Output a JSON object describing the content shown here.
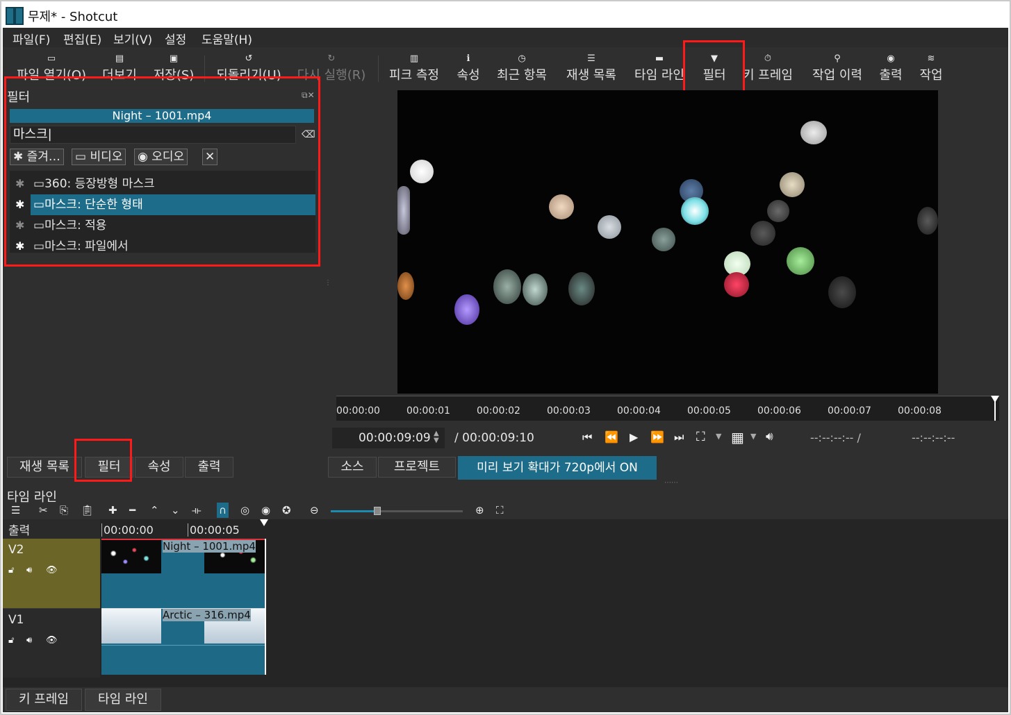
{
  "window": {
    "title": "무제* - Shotcut"
  },
  "menu": [
    "파일(F)",
    "편집(E)",
    "보기(V)",
    "설정",
    "도움말(H)"
  ],
  "toolbar": [
    {
      "label": "파일 열기(O)",
      "icon": "folder-open-icon",
      "enabled": true
    },
    {
      "label": "더보기",
      "icon": "file-icon",
      "enabled": true
    },
    {
      "label": "저장(S)",
      "icon": "save-icon",
      "enabled": true
    },
    {
      "label": "되돌리기(U)",
      "icon": "undo-icon",
      "enabled": true
    },
    {
      "label": "다시 실행(R)",
      "icon": "redo-icon",
      "enabled": false
    },
    {
      "label": "피크 측정",
      "icon": "peak-meter-icon",
      "enabled": true
    },
    {
      "label": "속성",
      "icon": "info-icon",
      "enabled": true
    },
    {
      "label": "최근 항목",
      "icon": "clock-icon",
      "enabled": true
    },
    {
      "label": "재생 목록",
      "icon": "list-icon",
      "enabled": true
    },
    {
      "label": "타임 라인",
      "icon": "timeline-icon",
      "enabled": true
    },
    {
      "label": "필터",
      "icon": "filter-icon",
      "enabled": true
    },
    {
      "label": "키 프레임",
      "icon": "stopwatch-icon",
      "enabled": true
    },
    {
      "label": "작업 이력",
      "icon": "history-icon",
      "enabled": true
    },
    {
      "label": "출력",
      "icon": "disc-icon",
      "enabled": true
    },
    {
      "label": "작업",
      "icon": "database-icon",
      "enabled": true
    }
  ],
  "filters_panel": {
    "title": "필터",
    "clip_name": "Night – 1001.mp4",
    "search_value": "마스크|",
    "chips": [
      "즐겨…",
      "비디오",
      "오디오"
    ],
    "items": [
      {
        "label": "360: 등장방형 마스크",
        "favorite": false,
        "selected": false
      },
      {
        "label": "마스크: 단순한 형태",
        "favorite": true,
        "selected": true
      },
      {
        "label": "마스크: 적용",
        "favorite": false,
        "selected": false
      },
      {
        "label": "마스크: 파일에서",
        "favorite": true,
        "selected": false
      }
    ]
  },
  "ruler": {
    "ticks": [
      "00:00:00",
      "00:00:01",
      "00:00:02",
      "00:00:03",
      "00:00:04",
      "00:00:05",
      "00:00:06",
      "00:00:07",
      "00:00:08"
    ]
  },
  "transport": {
    "position": "00:00:09:09",
    "duration": "/ 00:00:09:10",
    "in_point": "--:--:--:-- /",
    "out_point": "--:--:--:--"
  },
  "left_tabs": [
    "재생 목록",
    "필터",
    "속성",
    "출력"
  ],
  "player_tabs": [
    "소스",
    "프로젝트"
  ],
  "preview_scaling_label": "미리 보기 확대가 720p에서 ON",
  "timeline": {
    "title": "타임 라인",
    "output_label": "출력",
    "ruler": [
      "00:00:00",
      "00:00:05"
    ],
    "zoom_level": 0.35,
    "tracks": [
      {
        "name": "V2",
        "clip": "Night – 1001.mp4"
      },
      {
        "name": "V1",
        "clip": "Arctic – 316.mp4"
      }
    ]
  },
  "bottom_tabs": [
    "키 프레임",
    "타임 라인"
  ],
  "colors": {
    "accent": "#1d6d8a",
    "highlight_box": "#ff1a1a",
    "v2_header": "#6b6527"
  }
}
